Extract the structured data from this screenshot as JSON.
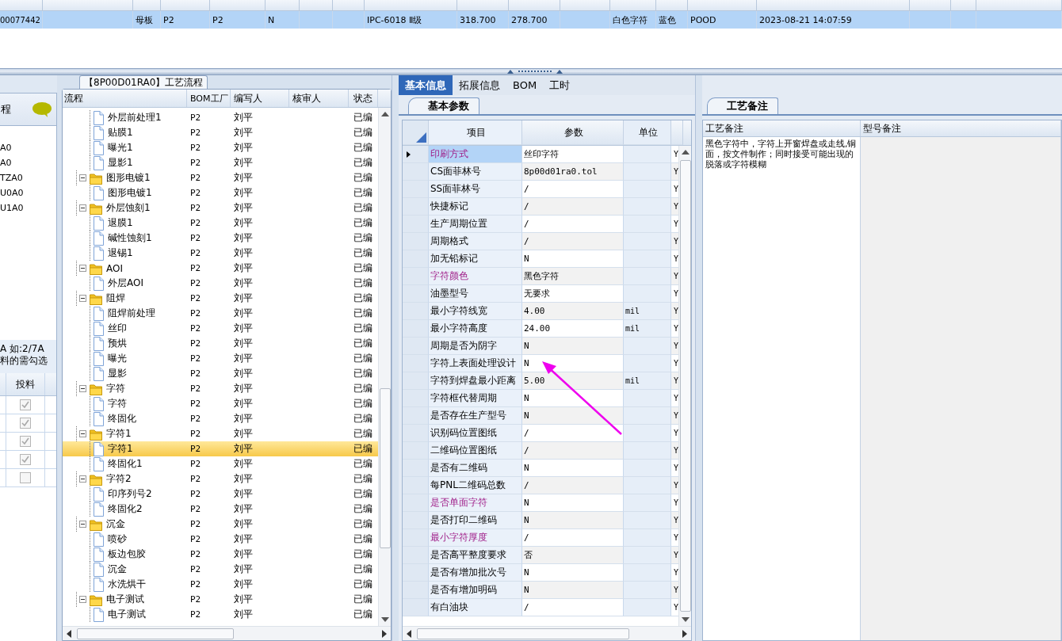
{
  "top_grid": {
    "row": {
      "selected": true,
      "cells": [
        "00077442",
        "",
        "母板",
        "P2",
        "P2",
        "N",
        "",
        "",
        "IPC-6018 Ⅱ级",
        "318.700",
        "278.700",
        "",
        "白色字符",
        "蓝色",
        "POOD",
        "2023-08-21 14:07:59",
        "",
        ""
      ]
    }
  },
  "left_panel": {
    "title": "程",
    "items": [
      "A0",
      "A0",
      "TZA0",
      "U0A0",
      "U1A0"
    ],
    "note": [
      "A 如:2/7A",
      "料的需勾选"
    ],
    "column": "投料",
    "checks": [
      {
        "checked": true
      },
      {
        "checked": true
      },
      {
        "checked": true
      },
      {
        "checked": true
      },
      {
        "checked": false
      }
    ]
  },
  "flow_panel": {
    "title": "【8P00D01RA0】工艺流程",
    "columns": [
      "流程",
      "BOM工厂",
      "编写人",
      "核审人",
      "状态"
    ],
    "tree": [
      {
        "kind": "file",
        "label": "外层前处理1",
        "bom": "P2",
        "writer": "刘平",
        "status": "已编",
        "selected": false
      },
      {
        "kind": "file",
        "label": "贴膜1",
        "bom": "P2",
        "writer": "刘平",
        "status": "已编",
        "selected": false
      },
      {
        "kind": "file",
        "label": "曝光1",
        "bom": "P2",
        "writer": "刘平",
        "status": "已编",
        "selected": false
      },
      {
        "kind": "file",
        "label": "显影1",
        "bom": "P2",
        "writer": "刘平",
        "status": "已编",
        "selected": false
      },
      {
        "kind": "folder",
        "label": "图形电镀1",
        "bom": "P2",
        "writer": "刘平",
        "status": "已编",
        "selected": false,
        "expanded": true,
        "children": [
          {
            "kind": "file",
            "label": "图形电镀1",
            "bom": "P2",
            "writer": "刘平",
            "status": "已编",
            "selected": false
          }
        ]
      },
      {
        "kind": "folder",
        "label": "外层蚀刻1",
        "bom": "P2",
        "writer": "刘平",
        "status": "已编",
        "selected": false,
        "expanded": true,
        "children": [
          {
            "kind": "file",
            "label": "退膜1",
            "bom": "P2",
            "writer": "刘平",
            "status": "已编",
            "selected": false
          },
          {
            "kind": "file",
            "label": "碱性蚀刻1",
            "bom": "P2",
            "writer": "刘平",
            "status": "已编",
            "selected": false
          },
          {
            "kind": "file",
            "label": "退锡1",
            "bom": "P2",
            "writer": "刘平",
            "status": "已编",
            "selected": false
          }
        ]
      },
      {
        "kind": "folder",
        "label": "AOI",
        "bom": "P2",
        "writer": "刘平",
        "status": "已编",
        "selected": false,
        "expanded": true,
        "children": [
          {
            "kind": "file",
            "label": "外层AOI",
            "bom": "P2",
            "writer": "刘平",
            "status": "已编",
            "selected": false
          }
        ]
      },
      {
        "kind": "folder",
        "label": "阻焊",
        "bom": "P2",
        "writer": "刘平",
        "status": "已编",
        "selected": false,
        "expanded": true,
        "children": [
          {
            "kind": "file",
            "label": "阻焊前处理",
            "bom": "P2",
            "writer": "刘平",
            "status": "已编",
            "selected": false
          },
          {
            "kind": "file",
            "label": "丝印",
            "bom": "P2",
            "writer": "刘平",
            "status": "已编",
            "selected": false
          },
          {
            "kind": "file",
            "label": "预烘",
            "bom": "P2",
            "writer": "刘平",
            "status": "已编",
            "selected": false
          },
          {
            "kind": "file",
            "label": "曝光",
            "bom": "P2",
            "writer": "刘平",
            "status": "已编",
            "selected": false
          },
          {
            "kind": "file",
            "label": "显影",
            "bom": "P2",
            "writer": "刘平",
            "status": "已编",
            "selected": false
          }
        ]
      },
      {
        "kind": "folder",
        "label": "字符",
        "bom": "P2",
        "writer": "刘平",
        "status": "已编",
        "selected": false,
        "expanded": true,
        "children": [
          {
            "kind": "file",
            "label": "字符",
            "bom": "P2",
            "writer": "刘平",
            "status": "已编",
            "selected": false
          },
          {
            "kind": "file",
            "label": "终固化",
            "bom": "P2",
            "writer": "刘平",
            "status": "已编",
            "selected": false
          }
        ]
      },
      {
        "kind": "folder",
        "label": "字符1",
        "bom": "P2",
        "writer": "刘平",
        "status": "已编",
        "selected": false,
        "expanded": true,
        "children": [
          {
            "kind": "file",
            "label": "字符1",
            "bom": "P2",
            "writer": "刘平",
            "status": "已编",
            "selected": true
          },
          {
            "kind": "file",
            "label": "终固化1",
            "bom": "P2",
            "writer": "刘平",
            "status": "已编",
            "selected": false
          }
        ]
      },
      {
        "kind": "folder",
        "label": "字符2",
        "bom": "P2",
        "writer": "刘平",
        "status": "已编",
        "selected": false,
        "expanded": true,
        "children": [
          {
            "kind": "file",
            "label": "印序列号2",
            "bom": "P2",
            "writer": "刘平",
            "status": "已编",
            "selected": false
          },
          {
            "kind": "file",
            "label": "终固化2",
            "bom": "P2",
            "writer": "刘平",
            "status": "已编",
            "selected": false
          }
        ]
      },
      {
        "kind": "folder",
        "label": "沉金",
        "bom": "P2",
        "writer": "刘平",
        "status": "已编",
        "selected": false,
        "expanded": true,
        "children": [
          {
            "kind": "file",
            "label": "喷砂",
            "bom": "P2",
            "writer": "刘平",
            "status": "已编",
            "selected": false
          },
          {
            "kind": "file",
            "label": "板边包胶",
            "bom": "P2",
            "writer": "刘平",
            "status": "已编",
            "selected": false
          },
          {
            "kind": "file",
            "label": "沉金",
            "bom": "P2",
            "writer": "刘平",
            "status": "已编",
            "selected": false
          },
          {
            "kind": "file",
            "label": "水洗烘干",
            "bom": "P2",
            "writer": "刘平",
            "status": "已编",
            "selected": false
          }
        ]
      },
      {
        "kind": "folder",
        "label": "电子测试",
        "bom": "P2",
        "writer": "刘平",
        "status": "已编",
        "selected": false,
        "expanded": true,
        "children": [
          {
            "kind": "file",
            "label": "电子测试",
            "bom": "P2",
            "writer": "刘平",
            "status": "已编",
            "selected": false
          }
        ]
      }
    ]
  },
  "info_panel": {
    "tabs": [
      {
        "label": "基本信息",
        "selected": true
      },
      {
        "label": "拓展信息",
        "selected": false
      },
      {
        "label": "BOM",
        "selected": false
      },
      {
        "label": "工时",
        "selected": false
      }
    ],
    "subtab": "基本参数",
    "columns": [
      "项目",
      "参数",
      "单位"
    ],
    "rows": [
      {
        "item": "印刷方式",
        "value": "丝印字符",
        "unit": "",
        "flag": "Y",
        "required": true,
        "selected": true
      },
      {
        "item": "CS面菲林号",
        "value": "8p00d01ra0.tol",
        "unit": "",
        "flag": "Y",
        "required": false,
        "selected": false
      },
      {
        "item": "SS面菲林号",
        "value": "/",
        "unit": "",
        "flag": "Y",
        "required": false,
        "selected": false
      },
      {
        "item": "快捷标记",
        "value": "/",
        "unit": "",
        "flag": "Y",
        "required": false,
        "selected": false
      },
      {
        "item": "生产周期位置",
        "value": "/",
        "unit": "",
        "flag": "Y",
        "required": false,
        "selected": false
      },
      {
        "item": "周期格式",
        "value": "/",
        "unit": "",
        "flag": "Y",
        "required": false,
        "selected": false
      },
      {
        "item": "加无铅标记",
        "value": "N",
        "unit": "",
        "flag": "Y",
        "required": false,
        "selected": false
      },
      {
        "item": "字符颜色",
        "value": "黑色字符",
        "unit": "",
        "flag": "Y",
        "required": true,
        "selected": false
      },
      {
        "item": "油墨型号",
        "value": "无要求",
        "unit": "",
        "flag": "Y",
        "required": false,
        "selected": false
      },
      {
        "item": "最小字符线宽",
        "value": "4.00",
        "unit": "mil",
        "flag": "Y",
        "required": false,
        "selected": false
      },
      {
        "item": "最小字符高度",
        "value": "24.00",
        "unit": "mil",
        "flag": "Y",
        "required": false,
        "selected": false
      },
      {
        "item": "周期是否为阴字",
        "value": "N",
        "unit": "",
        "flag": "Y",
        "required": false,
        "selected": false
      },
      {
        "item": "字符上表面处理设计",
        "value": "N",
        "unit": "",
        "flag": "Y",
        "required": false,
        "selected": false
      },
      {
        "item": "字符到焊盘最小距离",
        "value": "5.00",
        "unit": "mil",
        "flag": "Y",
        "required": false,
        "selected": false
      },
      {
        "item": "字符框代替周期",
        "value": "N",
        "unit": "",
        "flag": "Y",
        "required": false,
        "selected": false
      },
      {
        "item": "是否存在生产型号",
        "value": "N",
        "unit": "",
        "flag": "Y",
        "required": false,
        "selected": false
      },
      {
        "item": "识别码位置图纸",
        "value": "/",
        "unit": "",
        "flag": "Y",
        "required": false,
        "selected": false
      },
      {
        "item": "二维码位置图纸",
        "value": "/",
        "unit": "",
        "flag": "Y",
        "required": false,
        "selected": false
      },
      {
        "item": "是否有二维码",
        "value": "N",
        "unit": "",
        "flag": "Y",
        "required": false,
        "selected": false
      },
      {
        "item": "每PNL二维码总数",
        "value": "/",
        "unit": "",
        "flag": "Y",
        "required": false,
        "selected": false
      },
      {
        "item": "是否单面字符",
        "value": "N",
        "unit": "",
        "flag": "Y",
        "required": true,
        "selected": false
      },
      {
        "item": "是否打印二维码",
        "value": "N",
        "unit": "",
        "flag": "Y",
        "required": false,
        "selected": false
      },
      {
        "item": "最小字符厚度",
        "value": "/",
        "unit": "",
        "flag": "Y",
        "required": true,
        "selected": false
      },
      {
        "item": "是否高平整度要求",
        "value": "否",
        "unit": "",
        "flag": "Y",
        "required": false,
        "selected": false
      },
      {
        "item": "是否有增加批次号",
        "value": "N",
        "unit": "",
        "flag": "Y",
        "required": false,
        "selected": false
      },
      {
        "item": "是否有增加明码",
        "value": "N",
        "unit": "",
        "flag": "Y",
        "required": false,
        "selected": false
      },
      {
        "item": "有白油块",
        "value": "/",
        "unit": "",
        "flag": "Y",
        "required": false,
        "selected": false
      }
    ]
  },
  "notes_panel": {
    "tab": "工艺备注",
    "columns": [
      "工艺备注",
      "型号备注"
    ],
    "process_note": "黑色字符中，字符上开窗焊盘或走线,铜面，按文件制作；同时接受可能出现的脱落或字符模糊"
  }
}
